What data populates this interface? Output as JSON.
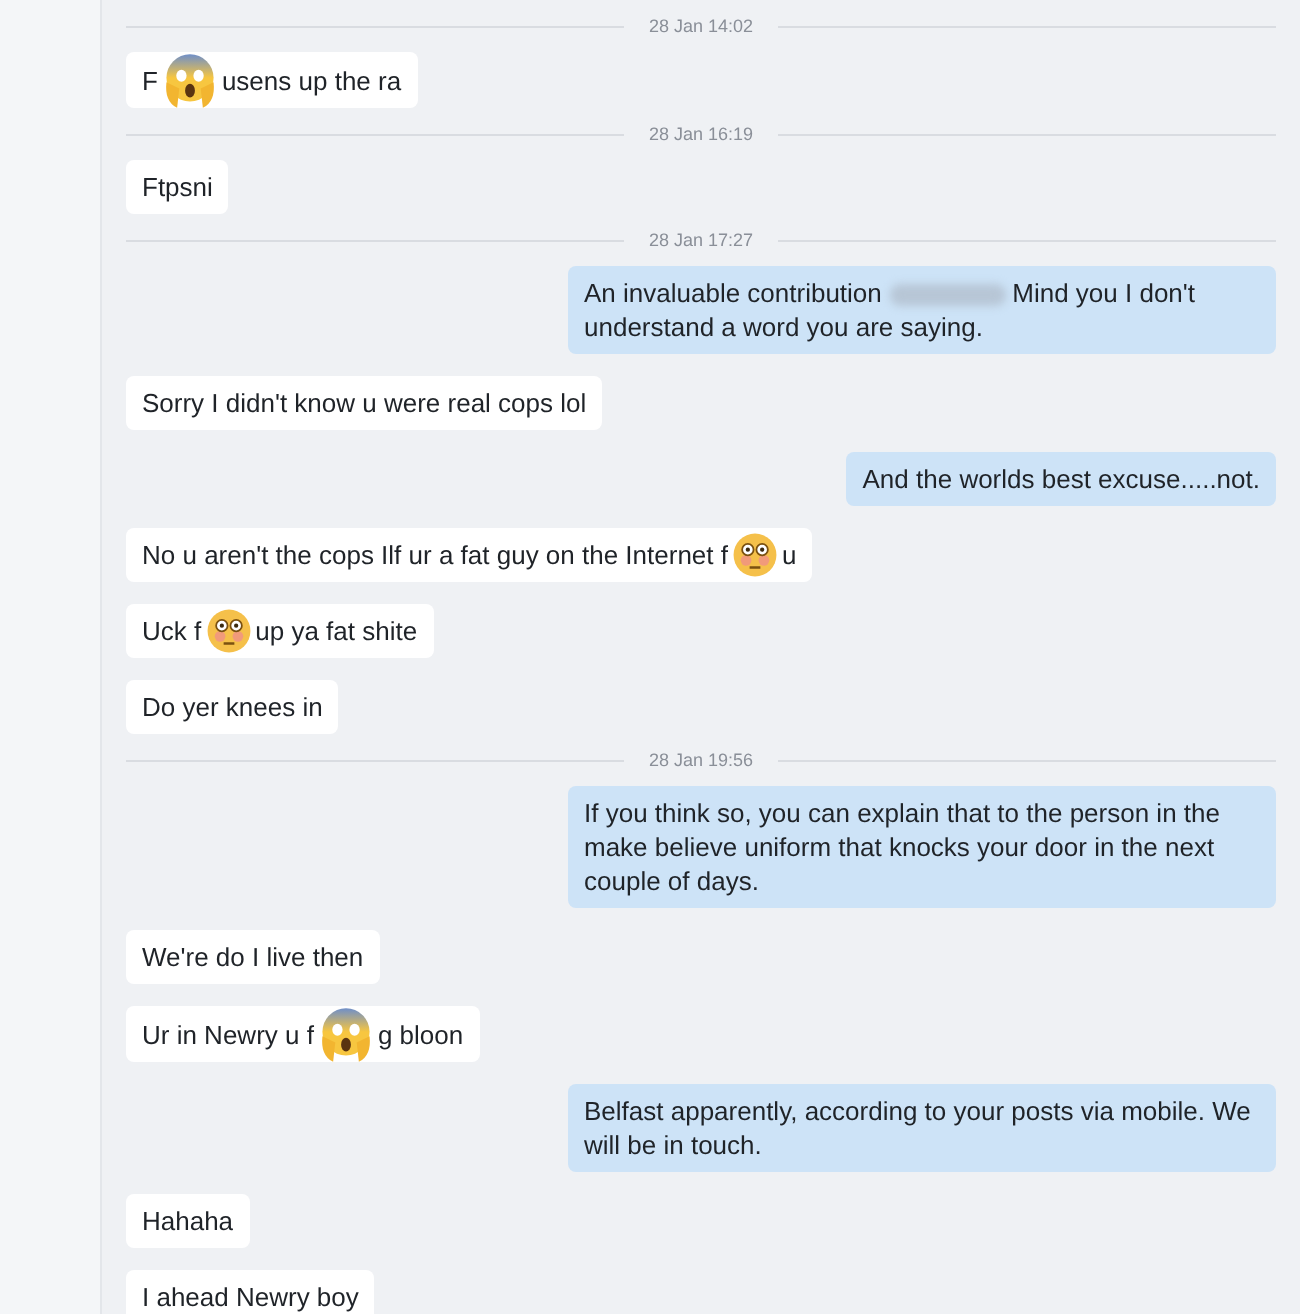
{
  "conversation": [
    {
      "kind": "date",
      "text": "28 Jan 14:02"
    },
    {
      "kind": "incoming",
      "parts": [
        {
          "kind": "text",
          "text": "F"
        },
        {
          "kind": "scream_emoji"
        },
        {
          "kind": "text",
          "text": "usens up the ra"
        }
      ]
    },
    {
      "kind": "date",
      "text": "28 Jan 16:19"
    },
    {
      "kind": "incoming",
      "parts": [
        {
          "kind": "text",
          "text": "Ftpsni"
        }
      ]
    },
    {
      "kind": "date",
      "text": "28 Jan 17:27"
    },
    {
      "kind": "outgoing",
      "parts": [
        {
          "kind": "text",
          "text": "An invaluable contribution"
        },
        {
          "kind": "redacted"
        },
        {
          "kind": "text",
          "text": "Mind you I don't understand a word you are saying."
        }
      ]
    },
    {
      "kind": "incoming",
      "parts": [
        {
          "kind": "text",
          "text": "Sorry I didn't know u were real cops lol"
        }
      ]
    },
    {
      "kind": "outgoing",
      "parts": [
        {
          "kind": "text",
          "text": "And the worlds best excuse.....not."
        }
      ]
    },
    {
      "kind": "incoming",
      "parts": [
        {
          "kind": "text",
          "text": "No u aren't the cops Ilf ur a fat guy on the Internet f"
        },
        {
          "kind": "flushed_emoji"
        },
        {
          "kind": "text",
          "text": "u"
        }
      ]
    },
    {
      "kind": "incoming",
      "parts": [
        {
          "kind": "text",
          "text": "Uck f"
        },
        {
          "kind": "flushed_emoji"
        },
        {
          "kind": "text",
          "text": "up ya fat shite"
        }
      ]
    },
    {
      "kind": "incoming",
      "parts": [
        {
          "kind": "text",
          "text": "Do yer knees in"
        }
      ]
    },
    {
      "kind": "date",
      "text": "28 Jan 19:56"
    },
    {
      "kind": "outgoing",
      "parts": [
        {
          "kind": "text",
          "text": "If you think so, you can explain that to the person in the make believe uniform that knocks your door in the next couple of days."
        }
      ]
    },
    {
      "kind": "incoming",
      "parts": [
        {
          "kind": "text",
          "text": "We're do I live then"
        }
      ]
    },
    {
      "kind": "incoming",
      "parts": [
        {
          "kind": "text",
          "text": "Ur in Newry u f"
        },
        {
          "kind": "scream_emoji"
        },
        {
          "kind": "text",
          "text": "g bloon"
        }
      ]
    },
    {
      "kind": "outgoing",
      "parts": [
        {
          "kind": "text",
          "text": "Belfast apparently, according to your posts via mobile. We will be in touch."
        }
      ]
    },
    {
      "kind": "incoming",
      "parts": [
        {
          "kind": "text",
          "text": "Hahaha"
        }
      ]
    },
    {
      "kind": "incoming",
      "parts": [
        {
          "kind": "text",
          "text": "I ahead Newry boy"
        }
      ]
    }
  ]
}
